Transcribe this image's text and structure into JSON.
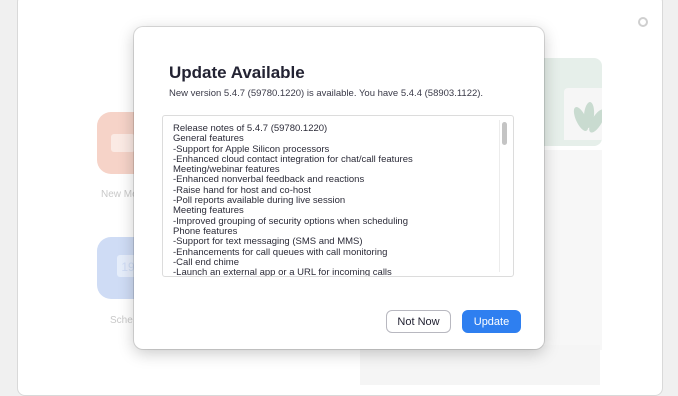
{
  "background": {
    "banner_text": "",
    "tile_labels": [
      "New Me",
      "Sche"
    ],
    "calendar_day": "19"
  },
  "dialog": {
    "title": "Update Available",
    "subtitle": "New version 5.4.7 (59780.1220) is available. You have 5.4.4 (58903.1122).",
    "release_notes": [
      "Release notes of 5.4.7 (59780.1220)",
      "General features",
      "-Support for Apple Silicon processors",
      "-Enhanced cloud contact integration for chat/call features",
      "Meeting/webinar features",
      "-Enhanced nonverbal feedback and reactions",
      "-Raise hand for host and co-host",
      "-Poll reports available during live session",
      "Meeting features",
      "-Improved grouping of security options when scheduling",
      "Phone features",
      "-Support for text messaging (SMS and MMS)",
      "-Enhancements for call queues with call monitoring",
      "-Call end chime",
      "-Launch an external app or a URL for incoming calls"
    ],
    "buttons": {
      "not_now": "Not Now",
      "update": "Update"
    }
  },
  "colors": {
    "accent": "#2e7ff0",
    "title_text": "#232333"
  }
}
